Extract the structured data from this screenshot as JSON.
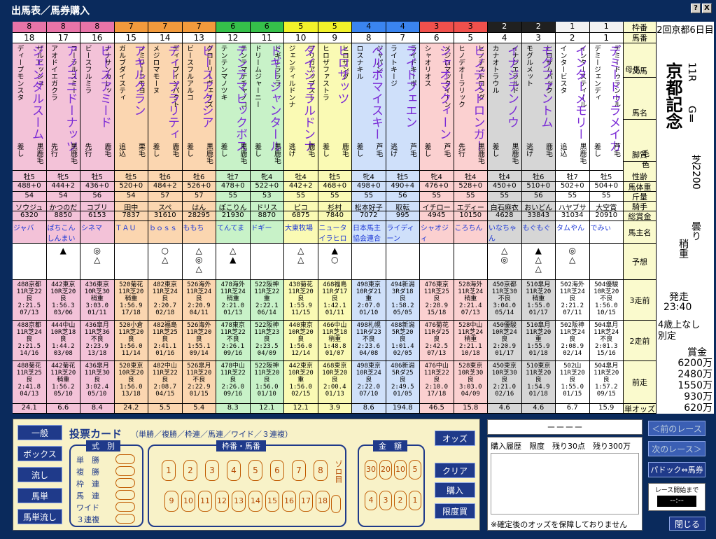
{
  "window": {
    "title": "出馬表／馬券購入",
    "help": "?",
    "close": "X"
  },
  "race": {
    "kaisai": "2回京都6日目",
    "raceno": "11R",
    "grade": "GⅡ",
    "name": "京都記念",
    "course": "芝2200",
    "weather": "曇り",
    "track": "稍重",
    "start_label": "発走",
    "start_time": "23:40",
    "cond": "4歳上なし",
    "cond2": "別定",
    "prize_label": "賞金",
    "prizes": [
      "6200万",
      "2480万",
      "1550万",
      "930万",
      "620万"
    ]
  },
  "labels": {
    "waku": "枠番",
    "umaban": "馬番",
    "bamei": "馬名",
    "sire": "父馬",
    "dam": "母馬",
    "kyakushitsu": "脚質",
    "keiro": "毛色",
    "seirei": "性齢",
    "weight": "馬体重",
    "kinryo": "斤量",
    "jockey": "騎手",
    "earnings": "総賞金",
    "owner": "馬主名",
    "yoso": "予想",
    "r3": "3走前",
    "r2": "2走前",
    "r1": "前走",
    "odds": "単オッズ"
  },
  "waku": [
    {
      "n": "8",
      "bg": "#f3c2d8",
      "head": "#e874a8"
    },
    {
      "n": "7",
      "bg": "#fbd6b0",
      "head": "#f29a3c"
    },
    {
      "n": "6",
      "bg": "#c8f2c8",
      "head": "#35c04a"
    },
    {
      "n": "5",
      "bg": "#fafab4",
      "head": "#f2f22a"
    },
    {
      "n": "4",
      "bg": "#cfe0fa",
      "head": "#3a84ef"
    },
    {
      "n": "3",
      "bg": "#fbd0d0",
      "head": "#f0504c"
    },
    {
      "n": "2",
      "bg": "#d6d6d6",
      "head": "#202020"
    },
    {
      "n": "1",
      "bg": "#ffffff",
      "head": "#f2f2f2"
    }
  ],
  "horses": [
    {
      "no": "18",
      "w": 0,
      "name": "ジェンダルスーム",
      "sire": "ザルビッシュ",
      "dam": "ディープモンスタ",
      "kk": "差し",
      "ke": "黒鹿毛",
      "age": "牡5",
      "bw": "488+0",
      "kin": "54",
      "jk": "ソウジュ",
      "ear": "6320",
      "own": "ジャバ",
      "mk": "",
      "r3": "488京都|11R芝22|良|2:21.5|07/13",
      "r2": "488京都|11R芝24|良|2:21.5|14/16",
      "r1": "488菊花|11R芝25|良|2:41.8|04/13",
      "od": "24.1"
    },
    {
      "no": "17",
      "w": 0,
      "name": "アノコニドーナッツ",
      "sire": "コーラルスミー",
      "dam": "アオドイエガクラ",
      "kk": "先行",
      "ke": "黒鹿毛",
      "age": "牝5",
      "bw": "444+2",
      "kin": "54",
      "jk": "かつのだ",
      "ear": "8850",
      "own": "ばちこん しんまい",
      "mk": "▲",
      "r3": "442東京|10R芝20|良|1:56.3|03/06",
      "r2": "444中山|10R芝18|良|1:44.2|03/08",
      "r1": "442菊花|11R芝20|稍重|1:56.2|05/10",
      "od": "6.6"
    },
    {
      "no": "16",
      "w": 0,
      "name": "ビースアミード",
      "sire": "ナナサンカレッ",
      "dam": "ビースフルミラ",
      "kk": "先行",
      "ke": "鹿毛",
      "age": "牡5",
      "bw": "436+0",
      "kin": "56",
      "jk": "コブリ",
      "ear": "6153",
      "own": "シネマ",
      "mk": "◎|△",
      "r3": "436東京|10R芝30|稍重|3:03.0|01/11",
      "r2": "436皐月|11R芝36|不良|2:23.9|13/18",
      "r1": "436皐月|11R芝30|良|3:02.4|05/10",
      "od": "8.4"
    },
    {
      "no": "15",
      "w": 1,
      "name": "アキルクラン",
      "sire": "ノミリーニモヨ",
      "dam": "ガルブダイスティ",
      "kk": "追込",
      "ke": "栗毛",
      "age": "牡5",
      "bw": "520+0",
      "kin": "54",
      "jk": "田中",
      "ear": "7837",
      "own": "ＴＡＵ",
      "mk": "",
      "r3": "520菊花|11R芝20|稍重|1:56.9|17/18",
      "r2": "520小倉|11R芝20|良|1:56.0|11/14",
      "r1": "520東京|10R芝20|良|1:56.0|13/18",
      "od": "24.2"
    },
    {
      "no": "14",
      "w": 1,
      "name": "ディープラリティ",
      "sire": "ディープインパクト",
      "dam": "メジロマモーヌ",
      "kk": "差し",
      "ke": "鹿毛",
      "age": "牡6",
      "bw": "484+2",
      "kin": "57",
      "jk": "スペ",
      "ear": "31610",
      "own": "ｂｏｓｓ",
      "mk": "○|△",
      "r3": "482東京|11R芝24|良|2:20.7|02/18",
      "r2": "482福島|11R芝25|良|2:41.1|01/16",
      "r1": "482中山|11R芝22|良|2:08.7|04/15",
      "od": "5.5"
    },
    {
      "no": "13",
      "w": 1,
      "name": "ビースアクシア",
      "sire": "グローリーヴェイズ",
      "dam": "ビースフルアルコ",
      "kk": "差し",
      "ke": "黒鹿毛",
      "age": "牡6",
      "bw": "526+0",
      "kin": "57",
      "jk": "はん",
      "ear": "28295",
      "own": "ももち",
      "mk": "△|◎|△",
      "r3": "526海外|11R芝24|良|2:20.9|04/11",
      "r2": "526海外|11R芝20|良|1:55.1|09/14",
      "r1": "526皐月|11R芝20|不良|2:22.9|01/15",
      "od": "5.4"
    },
    {
      "no": "12",
      "w": 2,
      "name": "テンテマビックボス",
      "sire": "テンテマナチャノコ",
      "dam": "テンテンマノツキ",
      "kk": "差し",
      "ke": "黒鹿毛",
      "age": "牡7",
      "bw": "478+0",
      "kin": "55",
      "jk": "ぽこりん",
      "ear": "21930",
      "own": "てんてま",
      "mk": "△|▲",
      "r3": "478海外|11R芝24|稍重|2:21.0|01/13",
      "r2": "478東京|11R芝22|不良|2:26.1|09/16",
      "r1": "478中山|11R芝22|良|2:26.0|09/16",
      "od": "8.3"
    },
    {
      "no": "11",
      "w": 2,
      "name": "ドギージャンタール",
      "sire": "ドギーラララ",
      "dam": "ドリームジャーニー",
      "kk": "差し",
      "ke": "黒鹿毛",
      "age": "牝4",
      "bw": "522+0",
      "kin": "53",
      "jk": "ドリス",
      "ear": "8870",
      "own": "ドギー",
      "mk": "",
      "r3": "522阪神|11R芝22|重|2:22.1|06/14",
      "r2": "522阪神|11R芝23|良|2:23.5|04/09",
      "r1": "522阪神|11R芝20|良|1:56.0|01/10",
      "od": "12.1"
    },
    {
      "no": "10",
      "w": 3,
      "name": "ダイジェラルドンナ",
      "sire": "フリガアッブスト",
      "dam": "ジェンティルドンナ",
      "kk": "逃げ",
      "ke": "鹿毛",
      "age": "牡4",
      "bw": "442+2",
      "kin": "55",
      "jk": "ピコ",
      "ear": "6875",
      "own": "大東牧場",
      "mk": "△|△",
      "r3": "438菊花|11R芝20|良|1:55.9|11/15",
      "r2": "440東京|10R芝20|良|1:56.0|12/14",
      "r1": "442東京|10R芝20|重|1:56.0|02/15",
      "od": "12.1"
    },
    {
      "no": "9",
      "w": 3,
      "name": "ヒロザッツ",
      "sire": "ヒロザング",
      "dam": "ヒロザファストラ",
      "kk": "差し",
      "ke": "鹿毛",
      "age": "牡5",
      "bw": "468+0",
      "kin": "55",
      "jk": "杉村",
      "ear": "7840",
      "own": "ニュータ イラヒロ",
      "mk": "▲|○",
      "r3": "468福島|11Rダ17|良|1:42.1|01/11",
      "r2": "466中山|11R芝18|稍重|1:48.8|01/07",
      "r1": "468東京|10R芝20|良|2:00.4|01/13",
      "od": "3.9"
    },
    {
      "no": "8",
      "w": 4,
      "name": "ベルボマイスキー",
      "sire": "ジャパン",
      "dam": "ロスナキル",
      "kk": "差し",
      "ke": "芦毛",
      "age": "牝4",
      "bw": "498+0",
      "kin": "55",
      "jk": "松本好子",
      "ear": "7072",
      "own": "日本馬主 協会連合会",
      "mk": "",
      "r3": "498東京|10Rダ21|重|2:07.0|01/10",
      "r2": "498札幌|11Rダ23|不良|2:23.6|04/08",
      "r1": "498東京|10R芝24|良|2:22.0|07/10",
      "od": "8.6"
    },
    {
      "no": "7",
      "w": 4,
      "name": "ライドフェエン",
      "sire": "ライドキーポ",
      "dam": "ライトキージ",
      "kk": "逃げ",
      "ke": "芦毛",
      "age": "牡5",
      "bw": "490+4",
      "kin": "56",
      "jk": "取転",
      "ear": "995",
      "own": "ライディ ーン",
      "mk": "",
      "r3": "494新潟|3Rダ18|良|1:58.2|05/05",
      "r2": "488新潟|5R芝20|良|1:01.4|02/05",
      "r1": "486新潟|5Rダ25|良|2:49.5|01/05",
      "od": "194.8"
    },
    {
      "no": "6",
      "w": 5,
      "name": "シャオマクィーン",
      "sire": "メジロマックイーン",
      "dam": "シャオリオス",
      "kk": "差し",
      "ke": "芦毛",
      "age": "牝4",
      "bw": "476+0",
      "kin": "55",
      "jk": "イチロー",
      "ear": "4945",
      "own": "シャオジ ィ",
      "mk": "",
      "r3": "476東京|11R芝25|良|2:28.9|15/18",
      "r2": "476菊花|11Rダ25|良|2:42.5|07/13",
      "r1": "476中山|11R芝22|良|2:10.0|17/18",
      "od": "46.5"
    },
    {
      "no": "5",
      "w": 5,
      "name": "ヒノデストロンガー",
      "sire": "ヒノデストロング",
      "dam": "ヒノデオーラリック",
      "kk": "先行",
      "ke": "黒鹿毛",
      "age": "牡4",
      "bw": "528+0",
      "kin": "55",
      "jk": "エディー",
      "ear": "10150",
      "own": "ころちん",
      "mk": "",
      "r3": "528海外|11R芝24|稍重|2:21.4|07/13",
      "r2": "528中山|11R芝24|稍重|2:21.1|10/18",
      "r1": "528東京|10R芝30|良|3:03.0|04/09",
      "od": "15.8"
    },
    {
      "no": "4",
      "w": 6,
      "name": "イナジテンノウ",
      "sire": "イナジエラルド",
      "dam": "カナオトラウル",
      "kk": "差し",
      "ke": "黒鹿毛",
      "age": "牡4",
      "bw": "450+0",
      "kin": "55",
      "jk": "白石麻衣",
      "ear": "4628",
      "own": "いなちゃ ん",
      "mk": "△|◎",
      "r3": "450京都|11R芝30|不良|3:04.0|05/14",
      "r2": "450優駿|10R芝24|良|2:20.9|01/17",
      "r1": "450東京|10R芝30|良|2:21.0|02/16",
      "od": "4.6"
    },
    {
      "no": "3",
      "w": 6,
      "name": "モグファントム",
      "sire": "ヒロザムパック",
      "dam": "モグルメット",
      "kk": "逃げ",
      "ke": "鹿毛",
      "age": "牡6",
      "bw": "510+0",
      "kin": "56",
      "jk": "おいどん",
      "ear": "33843",
      "own": "もぐもぐ",
      "mk": "▲|△|△",
      "r3": "510皐月|11R芝20|稍重|1:55.0|01/17",
      "r2": "510皐月|11R芝20|重|1:55.9|01/18",
      "r1": "510東京|11R芝20|良|1:54.9|01/18",
      "od": "4.6"
    },
    {
      "no": "2",
      "w": 7,
      "name": "インターメモリー",
      "sire": "インタースティール",
      "dam": "インタービスタ",
      "kk": "追込",
      "ke": "黒鹿毛",
      "age": "牡7",
      "bw": "502+0",
      "kin": "55",
      "jk": "ハヤブサ",
      "ear": "31034",
      "own": "タムやん",
      "mk": "◎|△",
      "r3": "502海外|11R芝24|良|2:21.2|07/11",
      "r2": "502阪神|11R芝24|良|2:08.9|02/14",
      "r1": "502山|11R芝20|良|1:55.0|01/15",
      "od": "6.7"
    },
    {
      "no": "1",
      "w": 7,
      "name": "デミードゥラメイカ",
      "sire": "デミードゥラントル",
      "dam": "デミージェンディ",
      "kk": "差し",
      "ke": "芦毛",
      "age": "牡5",
      "bw": "504+0",
      "kin": "55",
      "jk": "大空賞",
      "ear": "20910",
      "own": "でみぃ",
      "mk": "",
      "r3": "504優駿|10R芝20|不良|1:56.0|10/15",
      "r2": "504皐月|11R芝24|不良|2:01.3|15/16",
      "r1": "504皐月|11R芝20|良|1:57.2|09/15",
      "od": "15.9"
    }
  ],
  "bet_types_buttons": [
    "一般",
    "ボックス",
    "流し",
    "馬単",
    "馬単流し"
  ],
  "card": {
    "title": "投票カード",
    "subtitle": "（単勝／複勝／枠連／馬連／ワイド／３連複）",
    "shiki_label": "式　別",
    "shiki": [
      "単　勝",
      "複　勝",
      "枠　連",
      "馬　連",
      "ワイド",
      "３連複"
    ],
    "numbers_label": "枠番・馬番",
    "row1": [
      "1",
      "2",
      "3",
      "4",
      "5",
      "6",
      "7",
      "8"
    ],
    "row2": [
      "9",
      "10",
      "11",
      "12",
      "13",
      "14",
      "15",
      "16",
      "17",
      "18"
    ],
    "zorome": "ゾロ目",
    "amount_label": "金　額",
    "amt1": [
      "30",
      "20",
      "10",
      "5"
    ],
    "amt2": [
      "4",
      "3",
      "2",
      "1"
    ]
  },
  "right_buttons": [
    "オッズ",
    "クリア",
    "購入",
    "限度買"
  ],
  "history": {
    "header": "－－－－",
    "title": "購入履歴　限度　残り30点　残り300万",
    "note": "※確定後のオッズを保障しておりません"
  },
  "nav": {
    "prev": "＜前のレース",
    "next": "次のレース＞",
    "paddock": "パドック⇔馬券",
    "until_label": "レース開始まで",
    "until_value": "--:--",
    "close": "閉じる"
  }
}
